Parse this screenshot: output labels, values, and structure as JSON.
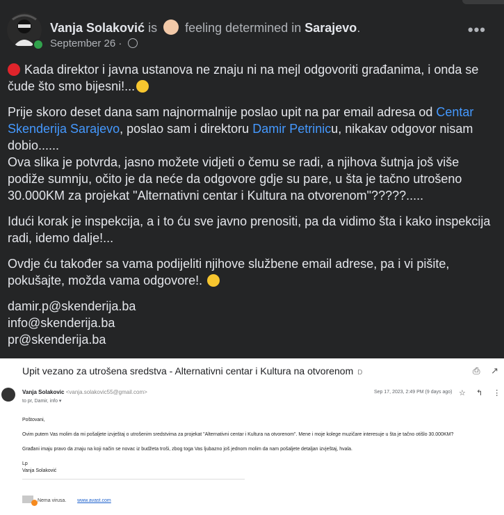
{
  "post": {
    "author": "Vanja Solaković",
    "is_text": "is",
    "feeling_text": "feeling determined in",
    "place": "Sarajevo",
    "place_suffix": ".",
    "date": "September 26",
    "date_sep": "·",
    "more_label": "•••",
    "p1": "Kada direktor i javna ustanova ne znaju ni na mejl odgovoriti građanima, i onda se čude što smo bijesni!...",
    "p2_a": "Prije skoro deset dana sam najnormalnije poslao upit na par email adresa od ",
    "p2_link1": "Centar Skenderija Sarajevo",
    "p2_b": ", poslao sam i direktoru ",
    "p2_link2": "Damir Petrinic",
    "p2_c": "u, nikakav odgovor nisam dobio......",
    "p2_d": "Ova slika je potvrda, jasno možete vidjeti o čemu se radi, a njihova šutnja još više podiže sumnju, očito je da neće da odgovore gdje su pare, u šta je tačno utrošeno 30.000KM za projekat \"Alternativni centar i Kultura na otvorenom\"?????.....",
    "p3": "Idući korak je inspekcija, a i to ću sve javno prenositi, pa da vidimo šta i kako inspekcija radi, idemo dalje!...",
    "p4": "Ovdje ću također sa vama podijeliti njihove službene email adrese, pa i vi pišite, pokušajte, možda vama odgovore!.",
    "emails": [
      "damir.p@skenderija.ba",
      "info@skenderija.ba",
      "pr@skenderija.ba"
    ]
  },
  "email": {
    "subject": "Upit vezano za utrošena sredstva - Alternativni centar i Kultura na otvorenom",
    "subject_icon": "D",
    "print_icon": "⎙",
    "external_icon": "↗",
    "sender_name": "Vanja Solakovic",
    "sender_addr": "<vanja.solakovic55@gmail.com>",
    "to": "to pr, Damir, info ▾",
    "date": "Sep 17, 2023, 2:49 PM (9 days ago)",
    "star_icon": "☆",
    "reply_icon": "↰",
    "menu_icon": "⋮",
    "greeting": "Poštovani,",
    "line1": "Ovim putem Vas molim da mi pošaljete izvještaj o utrošenim sredstvima za projekat \"Alternativni centar i Kultura na otvorenom\". Mene i moje kolege muzičare interesuje u šta je tačno otišlo 30.000KM?",
    "line2": "Građani imaju pravo da znaju na koji način se novac iz budžeta troši, zbog toga Vas ljubazno još jednom molim da nam pošaljete detaljan izvještaj, hvala.",
    "sig1": "Lp",
    "sig2": "Vanja Solaković",
    "avast_text": "Nema virusa.",
    "avast_link": "www.avast.com"
  },
  "colors": {
    "link": "#4599ff",
    "post_bg": "#242526",
    "online": "#31a24c"
  }
}
